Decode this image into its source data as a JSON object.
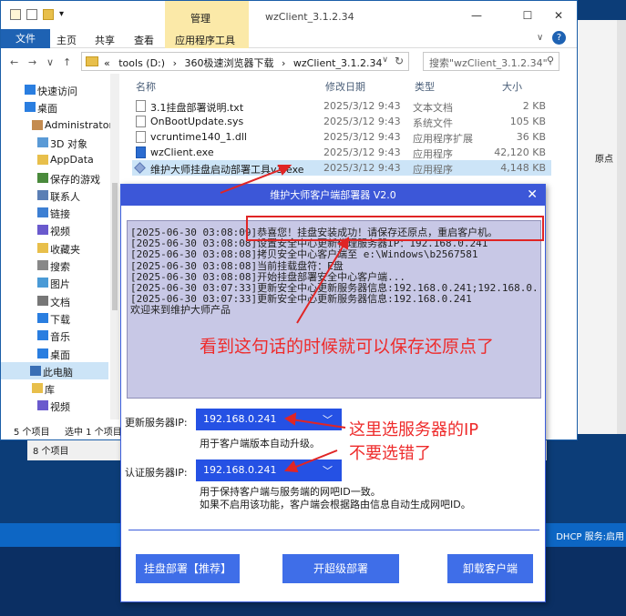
{
  "desktop": {
    "dhcp_text": "DHCP 服务:启用"
  },
  "background_window": {
    "partial_text": "原点",
    "status_count": "8 个项目"
  },
  "explorer": {
    "title": "wzClient_3.1.2.34",
    "manage_tab": "管理",
    "ribbon_tabs": [
      "文件",
      "主页",
      "共享",
      "查看",
      "应用程序工具"
    ],
    "path": [
      "tools (D:)",
      "360极速浏览器下载",
      "wzClient_3.1.2.34"
    ],
    "path_overflow": "«",
    "search_placeholder": "搜索\"wzClient_3.1.2.34\"",
    "columns": {
      "name": "名称",
      "date": "修改日期",
      "type": "类型",
      "size": "大小"
    },
    "files": [
      {
        "name": "3.1挂盘部署说明.txt",
        "date": "2025/3/12 9:43",
        "type": "文本文档",
        "size": "2 KB",
        "icon": "text-file-icon"
      },
      {
        "name": "OnBootUpdate.sys",
        "date": "2025/3/12 9:43",
        "type": "系统文件",
        "size": "105 KB",
        "icon": "system-file-icon"
      },
      {
        "name": "vcruntime140_1.dll",
        "date": "2025/3/12 9:43",
        "type": "应用程序扩展",
        "size": "36 KB",
        "icon": "dll-file-icon"
      },
      {
        "name": "wzClient.exe",
        "date": "2025/3/12 9:43",
        "type": "应用程序",
        "size": "42,120 KB",
        "icon": "exe-file-icon"
      },
      {
        "name": "维护大师挂盘启动部署工具v3.exe",
        "date": "2025/3/12 9:43",
        "type": "应用程序",
        "size": "4,148 KB",
        "icon": "tool-exe-icon"
      }
    ],
    "sidebar": [
      {
        "label": "快速访问",
        "icon": "star-icon"
      },
      {
        "label": "桌面",
        "icon": "desktop-icon"
      },
      {
        "label": "Administrator",
        "icon": "user-icon"
      },
      {
        "label": "3D 对象",
        "icon": "cube-icon"
      },
      {
        "label": "AppData",
        "icon": "folder-icon"
      },
      {
        "label": "保存的游戏",
        "icon": "game-icon"
      },
      {
        "label": "联系人",
        "icon": "contacts-icon"
      },
      {
        "label": "链接",
        "icon": "link-icon"
      },
      {
        "label": "视频",
        "icon": "video-icon"
      },
      {
        "label": "收藏夹",
        "icon": "favorites-icon"
      },
      {
        "label": "搜索",
        "icon": "search-icon"
      },
      {
        "label": "图片",
        "icon": "picture-icon"
      },
      {
        "label": "文档",
        "icon": "document-icon"
      },
      {
        "label": "下载",
        "icon": "download-icon"
      },
      {
        "label": "音乐",
        "icon": "music-icon"
      },
      {
        "label": "桌面",
        "icon": "desktop-icon"
      },
      {
        "label": "此电脑",
        "icon": "computer-icon"
      },
      {
        "label": "库",
        "icon": "library-icon"
      },
      {
        "label": "视频",
        "icon": "video-icon"
      }
    ],
    "status": {
      "count": "5 个项目",
      "selected": "选中 1 个项目 4.04 MB"
    }
  },
  "dialog": {
    "title": "维护大师客户端部署器 V2.0",
    "log": [
      "[2025-06-30 03:08:09]恭喜您！挂盘安装成功！请保存还原点，重启客户机。",
      "[2025-06-30 03:08:08]设置安全中心更新代理服务器IP：192.168.0.241",
      "[2025-06-30 03:08:08]拷贝安全中心客户端至 e:\\Windows\\b2567581",
      "[2025-06-30 03:08:08]当前挂载盘符：E盘",
      "[2025-06-30 03:08:08]开始挂盘部署安全中心客户端...",
      "[2025-06-30 03:07:33]更新安全中心更新服务器信息:192.168.0.241;192.168.0.",
      "[2025-06-30 03:07:33]更新安全中心更新服务器信息:192.168.0.241",
      "欢迎来到维护大师产品"
    ],
    "annotation_log": "看到这句话的时候就可以保存还原点了",
    "annotation_server": [
      "这里选服务器的IP",
      "不要选错了"
    ],
    "update_server": {
      "label": "更新服务器IP:",
      "value": "192.168.0.241",
      "note": "用于客户端版本自动升级。"
    },
    "auth_server": {
      "label": "认证服务器IP:",
      "value": "192.168.0.241",
      "notes": [
        "用于保持客户端与服务端的网吧ID一致。",
        "如果不启用该功能，客户端会根据路由信息自动生成网吧ID。"
      ]
    },
    "buttons": {
      "mount": "挂盘部署【推荐】",
      "super": "开超级部署",
      "uninstall": "卸载客户端"
    },
    "colors": {
      "title_bar": "#3c57d8",
      "accent": "#2551e4",
      "annotation": "#ee2b2b"
    }
  }
}
